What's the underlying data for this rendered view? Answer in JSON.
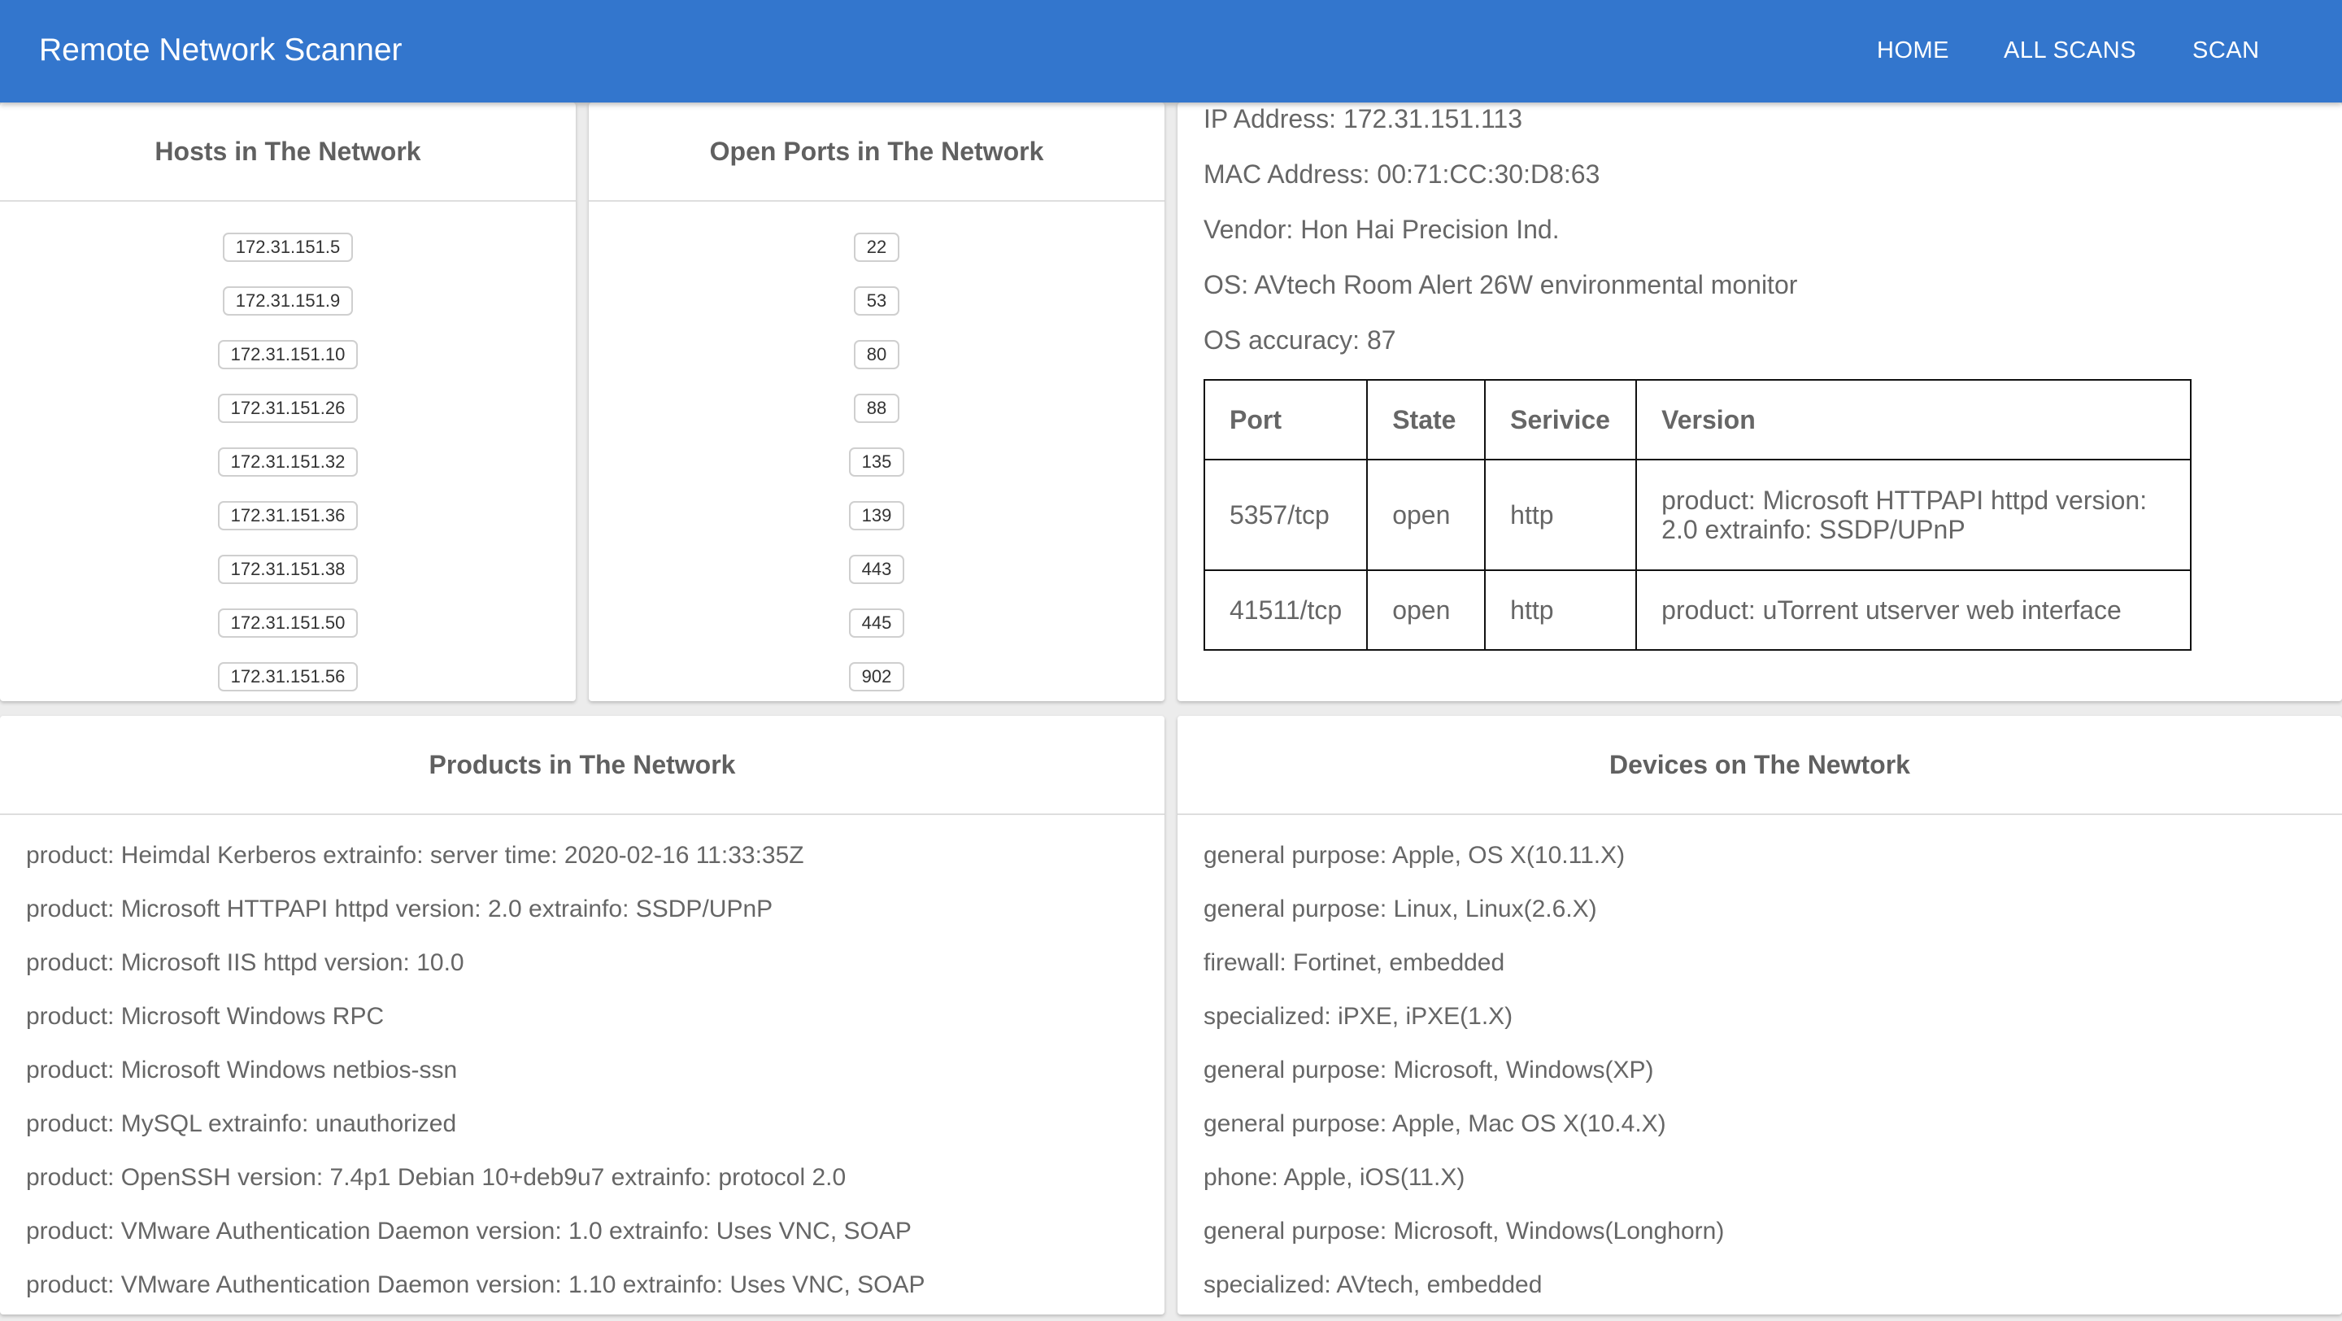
{
  "appbar": {
    "title": "Remote Network Scanner",
    "nav": [
      "HOME",
      "ALL SCANS",
      "SCAN"
    ]
  },
  "hosts": {
    "title": "Hosts in The Network",
    "items": [
      "172.31.151.5",
      "172.31.151.9",
      "172.31.151.10",
      "172.31.151.26",
      "172.31.151.32",
      "172.31.151.36",
      "172.31.151.38",
      "172.31.151.50",
      "172.31.151.56"
    ]
  },
  "ports": {
    "title": "Open Ports in The Network",
    "items": [
      "22",
      "53",
      "80",
      "88",
      "135",
      "139",
      "443",
      "445",
      "902"
    ]
  },
  "host_detail": {
    "ip": "IP Address: 172.31.151.113",
    "mac": "MAC Address: 00:71:CC:30:D8:63",
    "vendor": "Vendor: Hon Hai Precision Ind.",
    "os": "OS: AVtech Room Alert 26W environmental monitor",
    "os_accuracy": "OS accuracy: 87",
    "table": {
      "headers": [
        "Port",
        "State",
        "Serivice",
        "Version"
      ],
      "rows": [
        [
          "5357/tcp",
          "open",
          "http",
          "product: Microsoft HTTPAPI httpd version: 2.0 extrainfo: SSDP/UPnP"
        ],
        [
          "41511/tcp",
          "open",
          "http",
          "product: uTorrent utserver web interface"
        ]
      ]
    }
  },
  "products": {
    "title": "Products in The Network",
    "items": [
      "product: Heimdal Kerberos extrainfo: server time: 2020-02-16 11:33:35Z",
      "product: Microsoft HTTPAPI httpd version: 2.0 extrainfo: SSDP/UPnP",
      "product: Microsoft IIS httpd version: 10.0",
      "product: Microsoft Windows RPC",
      "product: Microsoft Windows netbios-ssn",
      "product: MySQL extrainfo: unauthorized",
      "product: OpenSSH version: 7.4p1 Debian 10+deb9u7 extrainfo: protocol 2.0",
      "product: VMware Authentication Daemon version: 1.0 extrainfo: Uses VNC, SOAP",
      "product: VMware Authentication Daemon version: 1.10 extrainfo: Uses VNC, SOAP"
    ]
  },
  "devices": {
    "title": "Devices on The Newtork",
    "items": [
      "general purpose: Apple, OS X(10.11.X)",
      "general purpose: Linux, Linux(2.6.X)",
      "firewall: Fortinet, embedded",
      "specialized: iPXE, iPXE(1.X)",
      "general purpose: Microsoft, Windows(XP)",
      "general purpose: Apple, Mac OS X(10.4.X)",
      "phone: Apple, iOS(11.X)",
      "general purpose: Microsoft, Windows(Longhorn)",
      "specialized: AVtech, embedded"
    ]
  }
}
